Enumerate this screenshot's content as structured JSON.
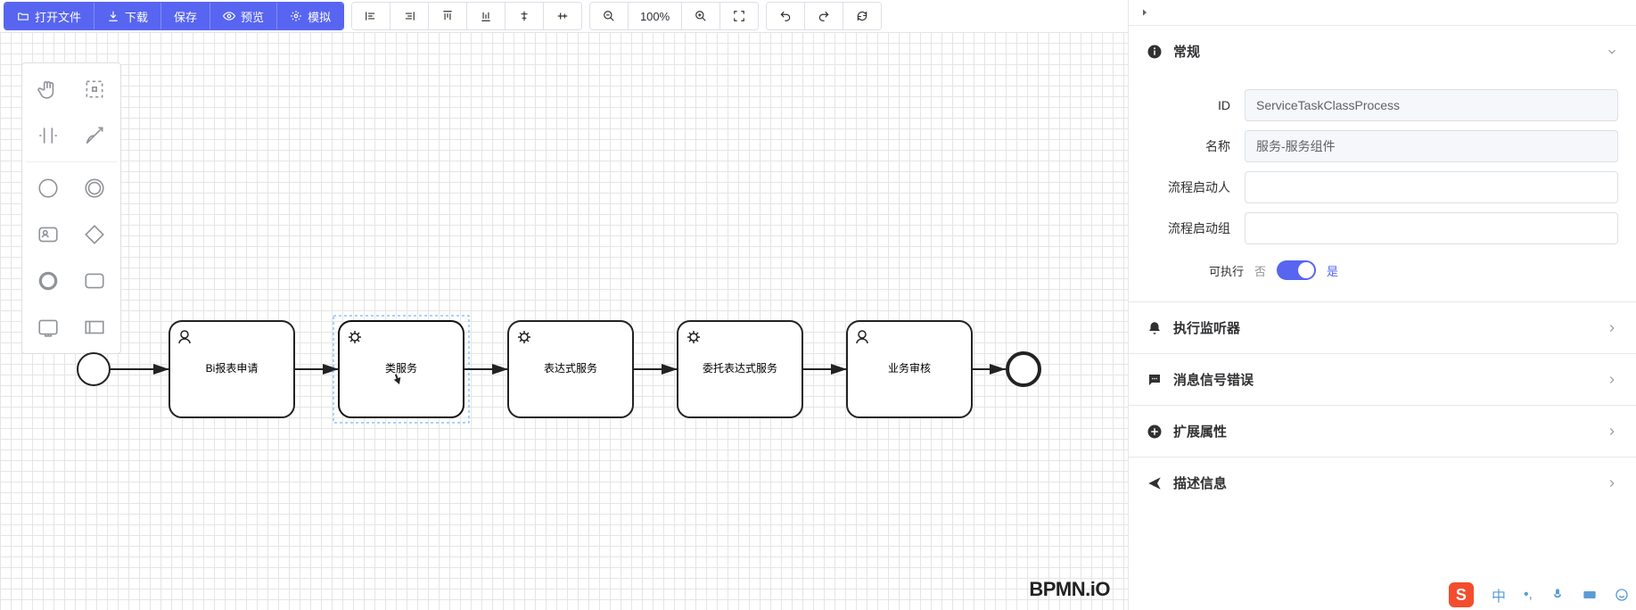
{
  "toolbar": {
    "open": "打开文件",
    "download": "下载",
    "save": "保存",
    "preview": "预览",
    "simulate": "模拟",
    "zoom": "100%"
  },
  "nodes": {
    "n1": "Bi报表申请",
    "n2": "类服务",
    "n3": "表达式服务",
    "n4": "委托表达式服务",
    "n5": "业务审核"
  },
  "watermark": "BPMN.iO",
  "panel": {
    "general": {
      "title": "常规",
      "id_label": "ID",
      "id_value": "ServiceTaskClassProcess",
      "name_label": "名称",
      "name_value": "服务-服务组件",
      "initiator_label": "流程启动人",
      "initiator_value": "",
      "start_group_label": "流程启动组",
      "start_group_value": "",
      "executable_label": "可执行",
      "no": "否",
      "yes": "是"
    },
    "sections": {
      "listeners": "执行监听器",
      "signals": "消息信号错误",
      "extensions": "扩展属性",
      "description": "描述信息"
    }
  },
  "tray": {
    "ime": "中"
  }
}
